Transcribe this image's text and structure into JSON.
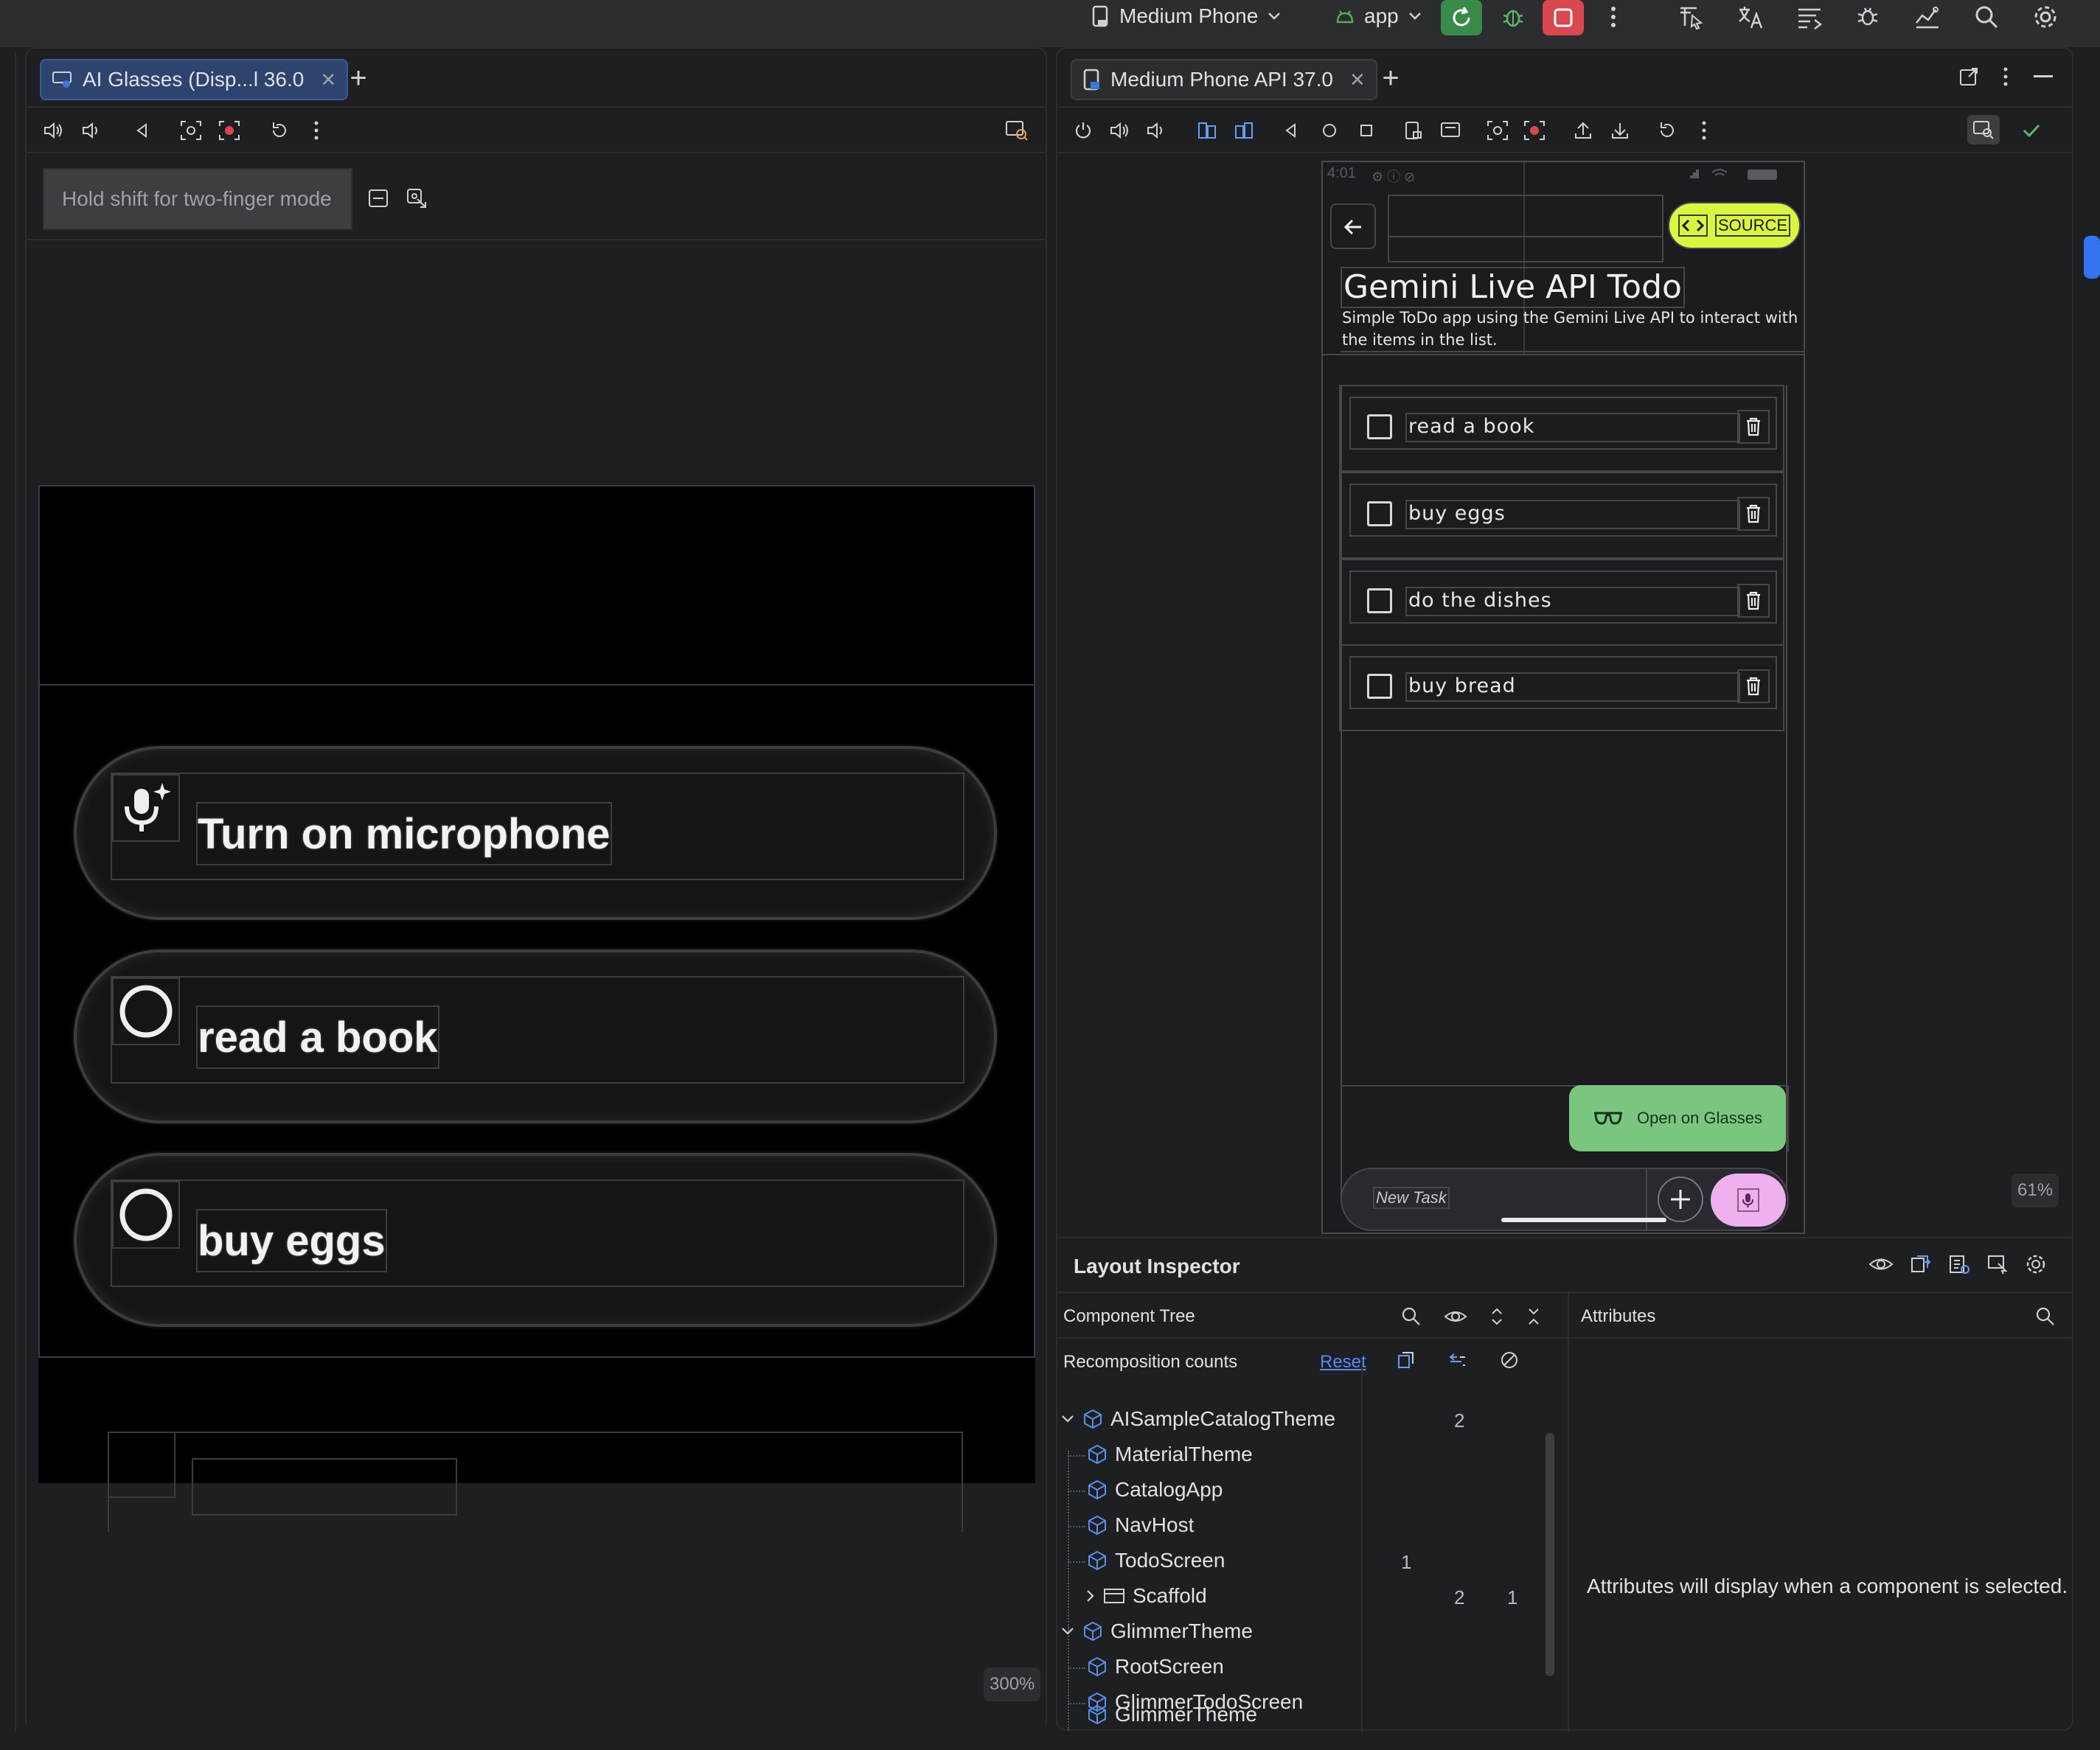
{
  "toolbar": {
    "device": "Medium Phone",
    "module": "app"
  },
  "left": {
    "tab_label": "AI Glasses (Disp...l 36.0",
    "shift_hint": "Hold shift for two-finger mode",
    "items": [
      {
        "label": "Turn on microphone",
        "icon": "mic-sparkle-icon"
      },
      {
        "label": "read a book",
        "icon": "radio-circle-icon"
      },
      {
        "label": "buy eggs",
        "icon": "radio-circle-icon"
      }
    ],
    "zoom": "300%"
  },
  "right": {
    "tab_label": "Medium Phone API 37.0",
    "status_time": "4:01",
    "source_label": "SOURCE",
    "app_title": "Gemini Live API Todo",
    "app_subtitle": "Simple ToDo app using the Gemini Live API to interact with the items in the list.",
    "todos": [
      "read a book",
      "buy eggs",
      "do the dishes",
      "buy bread"
    ],
    "open_glasses": "Open on Glasses",
    "new_task_placeholder": "New Task",
    "zoom": "61%"
  },
  "inspector": {
    "title": "Layout Inspector",
    "component_tree": "Component Tree",
    "recomposition": "Recomposition counts",
    "reset": "Reset",
    "attributes": "Attributes",
    "attributes_empty": "Attributes will display when a component is selected.",
    "tree": [
      {
        "name": "AISampleCatalogTheme",
        "c1": "",
        "c2": "2"
      },
      {
        "name": "MaterialTheme",
        "c1": "",
        "c2": ""
      },
      {
        "name": "CatalogApp",
        "c1": "",
        "c2": ""
      },
      {
        "name": "NavHost",
        "c1": "",
        "c2": ""
      },
      {
        "name": "TodoScreen",
        "c1": "1",
        "c2": ""
      },
      {
        "name": "Scaffold",
        "c1": "",
        "c2": "2",
        "c3": "1"
      },
      {
        "name": "GlimmerTheme",
        "c1": "",
        "c2": ""
      },
      {
        "name": "RootScreen",
        "c1": "",
        "c2": ""
      },
      {
        "name": "GlimmerTodoScreen",
        "c1": "",
        "c2": ""
      },
      {
        "name": "GlimmerTheme",
        "c1": "",
        "c2": ""
      }
    ]
  },
  "colors": {
    "accent_green": "#4caf50",
    "source_yellow": "#dcf542",
    "glasses_green": "#7bc67f",
    "mic_pink": "#efb0ee",
    "link_blue": "#548af7"
  }
}
